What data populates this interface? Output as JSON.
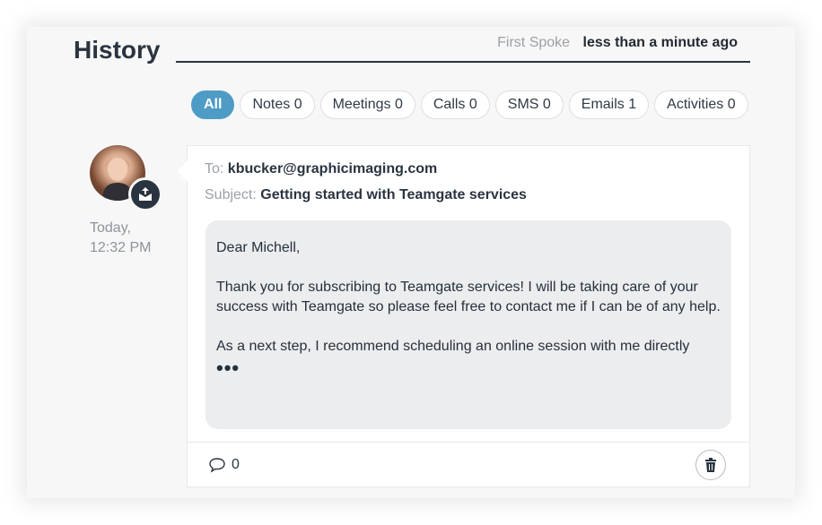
{
  "header": {
    "title": "History",
    "first_spoke_label": "First Spoke",
    "first_spoke_value": "less than a minute ago"
  },
  "filters": [
    {
      "label": "All",
      "active": true
    },
    {
      "label": "Notes 0",
      "active": false
    },
    {
      "label": "Meetings 0",
      "active": false
    },
    {
      "label": "Calls 0",
      "active": false
    },
    {
      "label": "SMS 0",
      "active": false
    },
    {
      "label": "Emails 1",
      "active": false
    },
    {
      "label": "Activities 0",
      "active": false
    }
  ],
  "entry": {
    "time_day": "Today,",
    "time_clock": "12:32 PM",
    "avatar_icon": "user-avatar",
    "badge_icon": "email-sent-icon",
    "to_label": "To:",
    "to_value": "kbucker@graphicimaging.com",
    "subject_label": "Subject:",
    "subject_value": "Getting started with Teamgate services",
    "body": {
      "greeting": "Dear Michell,",
      "paragraph1": "Thank you for subscribing to Teamgate services! I will be taking care of your success with Teamgate so please feel free to contact me if I can be of any help.",
      "paragraph2": "As a next step, I recommend scheduling an online session with me directly",
      "more": "•••"
    },
    "comment_count": "0"
  },
  "colors": {
    "accent": "#4e9cc6",
    "dark": "#2a3440",
    "muted": "#9aa1a8"
  }
}
